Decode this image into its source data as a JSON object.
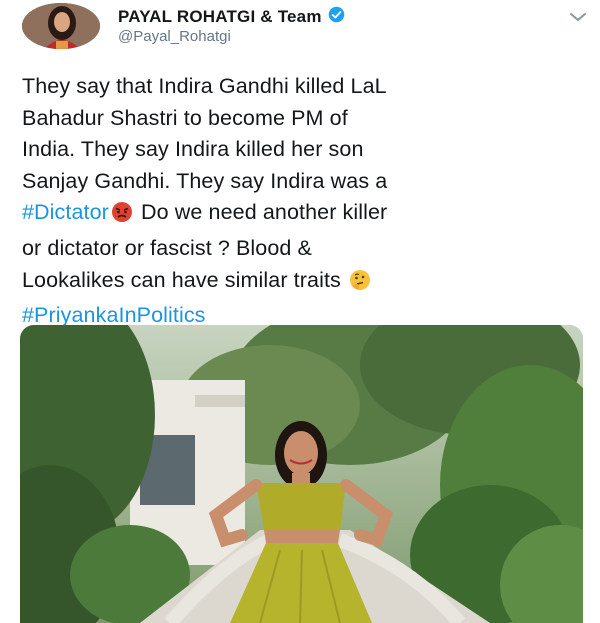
{
  "header": {
    "name": "PAYAL ROHATGI & Team",
    "handle": "@Payal_Rohatgi",
    "verified_icon": "verified-badge-icon",
    "menu_icon": "chevron-down-icon",
    "avatar_icon": "profile-photo"
  },
  "tweet": {
    "line1": "They say that Indira Gandhi killed LaL",
    "line2": "Bahadur Shastri to become PM of",
    "line3": "India. They say Indira killed her son",
    "line4": "Sanjay Gandhi. They say Indira was a",
    "hashtag1": "#Dictator",
    "line5_rest": "Do we need another killer",
    "line6": "or dictator or fascist ? Blood &",
    "line7": "Lookalikes can have similar traits",
    "hashtag2": "#PriyankaInPolitics",
    "emoji1": "angry-face-emoji",
    "emoji2": "thinking-face-emoji"
  },
  "media": {
    "photo_icon": "woman-standing-garden-photo",
    "colors": {
      "skirt": "#b5b42c",
      "foliage": "#4d6b3c",
      "path": "#d9d6cf"
    }
  },
  "colors": {
    "link": "#1b95e0",
    "verified": "#1da1f2",
    "text": "#14171a",
    "muted": "#657786"
  }
}
